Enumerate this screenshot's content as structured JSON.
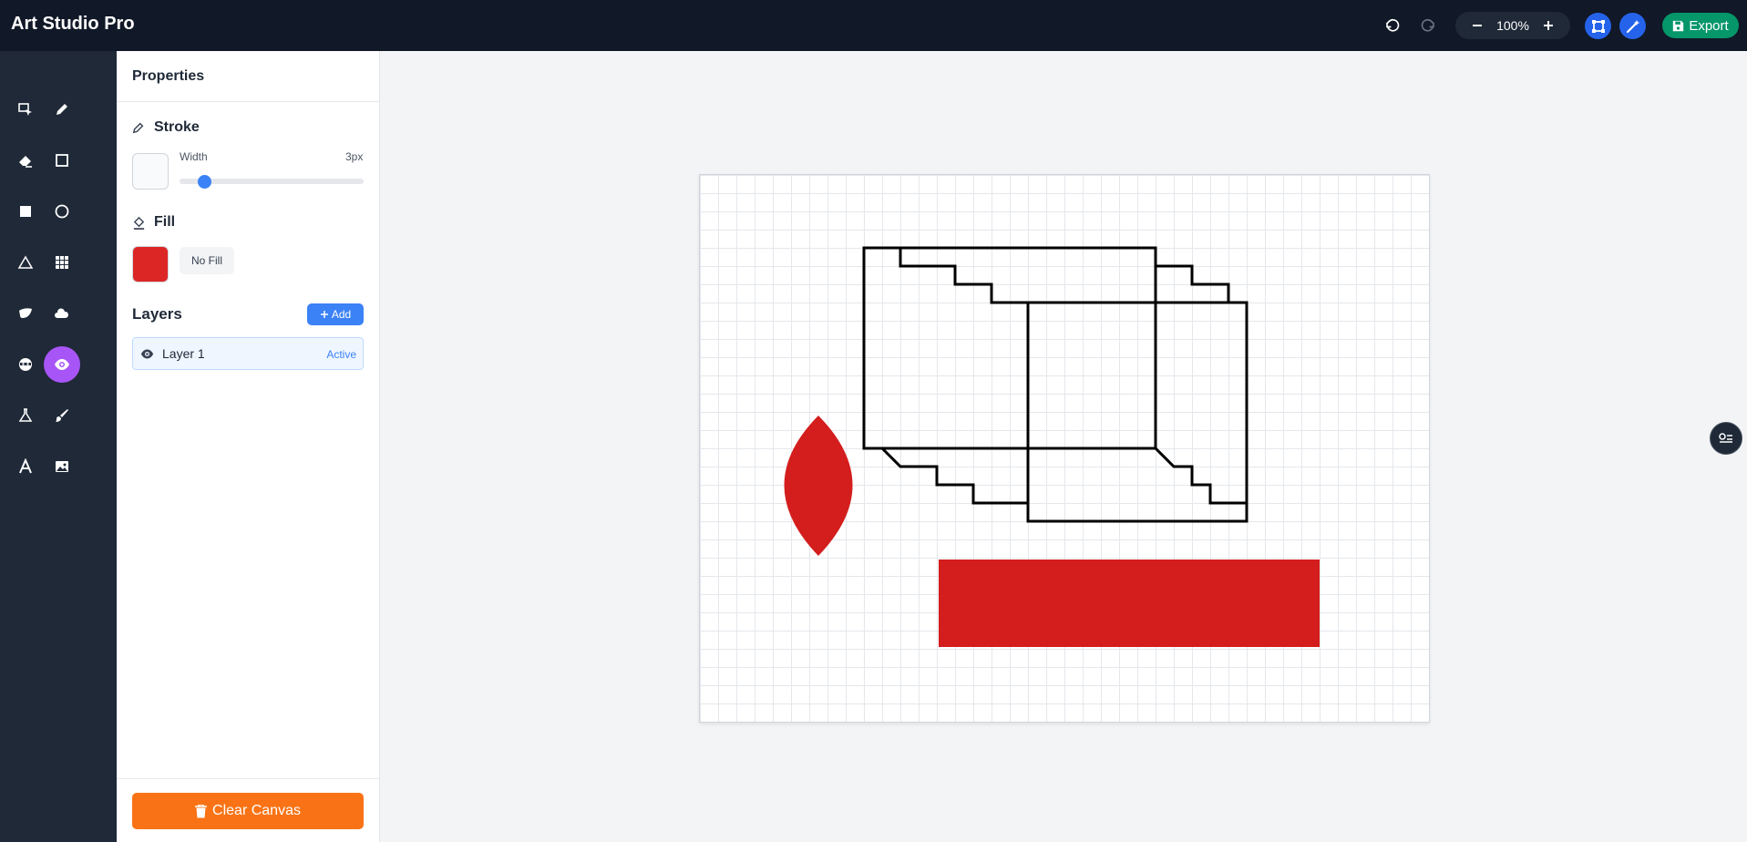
{
  "app": {
    "title": "Art Studio Pro"
  },
  "toolbar": {
    "undo_icon": "undo-icon",
    "redo_icon": "redo-icon",
    "zoom": {
      "value": "100%",
      "minus_icon": "minus-icon",
      "plus_icon": "plus-icon"
    },
    "transform_icon": "transform-icon",
    "magic_icon": "magic-wand-icon",
    "export_label": "Export",
    "export_icon": "save-icon"
  },
  "tools": [
    {
      "name": "select-tool",
      "icon": "select-icon",
      "active": false
    },
    {
      "name": "pencil-tool",
      "icon": "pencil-icon",
      "active": false
    },
    {
      "name": "eraser-tool",
      "icon": "eraser-icon",
      "active": false
    },
    {
      "name": "rectangle-outline-tool",
      "icon": "square-outline-icon",
      "active": false
    },
    {
      "name": "rectangle-fill-tool",
      "icon": "square-fill-icon",
      "active": false
    },
    {
      "name": "circle-tool",
      "icon": "circle-icon",
      "active": false
    },
    {
      "name": "triangle-tool",
      "icon": "triangle-icon",
      "active": false
    },
    {
      "name": "grid-tool",
      "icon": "grid-icon",
      "active": false
    },
    {
      "name": "leaf-tool",
      "icon": "leaf-icon",
      "active": false
    },
    {
      "name": "cloud-tool",
      "icon": "cloud-icon",
      "active": false
    },
    {
      "name": "mask-tool",
      "icon": "mask-icon",
      "active": false
    },
    {
      "name": "eye-tool",
      "icon": "eye-icon",
      "active": true
    },
    {
      "name": "flask-tool",
      "icon": "flask-icon",
      "active": false
    },
    {
      "name": "brush-tool",
      "icon": "brush-icon",
      "active": false
    },
    {
      "name": "text-tool",
      "icon": "text-icon",
      "active": false
    },
    {
      "name": "image-tool",
      "icon": "image-icon",
      "active": false
    }
  ],
  "properties": {
    "title": "Properties",
    "stroke": {
      "title": "Stroke",
      "color": "#f9fafb",
      "width_label": "Width",
      "width_value": "3px",
      "width_level": 3
    },
    "fill": {
      "title": "Fill",
      "color": "#dc2626",
      "no_fill_label": "No Fill"
    }
  },
  "layers": {
    "title": "Layers",
    "add_label": "Add",
    "items": [
      {
        "name": "Layer 1",
        "status": "Active"
      }
    ]
  },
  "clear_label": "Clear Canvas",
  "colors": {
    "accent": "#3b82f6",
    "active_tool": "#a855f7",
    "export": "#059669",
    "clear": "#f97316",
    "fill_red": "#dc2626"
  }
}
